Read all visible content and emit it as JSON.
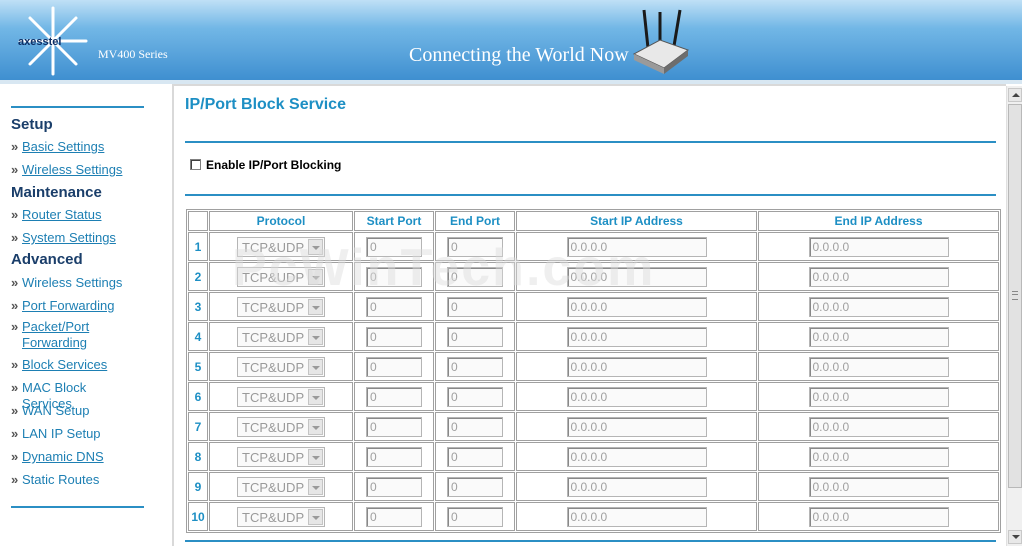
{
  "header": {
    "logo_text": "axesstel",
    "series": "MV400 Series",
    "tagline": "Connecting the World Now",
    "logo_icon": "starburst-logo-icon",
    "router_icon": "router-icon"
  },
  "colors": {
    "accent": "#2b8fc4",
    "link": "#1d7fb3",
    "heading": "#1a3e6a"
  },
  "sidebar": {
    "sections": [
      {
        "heading": "Setup",
        "items": [
          {
            "label": "Basic Settings",
            "link": true
          },
          {
            "label": "Wireless Settings",
            "link": true
          }
        ]
      },
      {
        "heading": "Maintenance",
        "items": [
          {
            "label": "Router Status",
            "link": true
          },
          {
            "label": "System Settings",
            "link": true
          }
        ]
      },
      {
        "heading": "Advanced",
        "items": [
          {
            "label": "Wireless Settings",
            "link": false
          },
          {
            "label": "Port Forwarding",
            "link": true
          },
          {
            "label": "Packet/Port Forwarding",
            "link": true
          },
          {
            "label": "Block Services",
            "link": true
          },
          {
            "label": "MAC Block Services",
            "link": false
          },
          {
            "label": "WAN Setup",
            "link": false
          },
          {
            "label": "LAN IP Setup",
            "link": false
          },
          {
            "label": "Dynamic DNS",
            "link": true
          },
          {
            "label": "Static Routes",
            "link": false
          }
        ]
      }
    ],
    "bullet": "»"
  },
  "main": {
    "title": "IP/Port Block Service",
    "enable_label": "Enable IP/Port Blocking",
    "table": {
      "headers": [
        "Protocol",
        "Start Port",
        "End Port",
        "Start IP Address",
        "End IP Address"
      ],
      "rows": [
        {
          "num": "1",
          "protocol": "TCP&UDP",
          "start_port": "0",
          "end_port": "0",
          "start_ip": "0.0.0.0",
          "end_ip": "0.0.0.0"
        },
        {
          "num": "2",
          "protocol": "TCP&UDP",
          "start_port": "0",
          "end_port": "0",
          "start_ip": "0.0.0.0",
          "end_ip": "0.0.0.0"
        },
        {
          "num": "3",
          "protocol": "TCP&UDP",
          "start_port": "0",
          "end_port": "0",
          "start_ip": "0.0.0.0",
          "end_ip": "0.0.0.0"
        },
        {
          "num": "4",
          "protocol": "TCP&UDP",
          "start_port": "0",
          "end_port": "0",
          "start_ip": "0.0.0.0",
          "end_ip": "0.0.0.0"
        },
        {
          "num": "5",
          "protocol": "TCP&UDP",
          "start_port": "0",
          "end_port": "0",
          "start_ip": "0.0.0.0",
          "end_ip": "0.0.0.0"
        },
        {
          "num": "6",
          "protocol": "TCP&UDP",
          "start_port": "0",
          "end_port": "0",
          "start_ip": "0.0.0.0",
          "end_ip": "0.0.0.0"
        },
        {
          "num": "7",
          "protocol": "TCP&UDP",
          "start_port": "0",
          "end_port": "0",
          "start_ip": "0.0.0.0",
          "end_ip": "0.0.0.0"
        },
        {
          "num": "8",
          "protocol": "TCP&UDP",
          "start_port": "0",
          "end_port": "0",
          "start_ip": "0.0.0.0",
          "end_ip": "0.0.0.0"
        },
        {
          "num": "9",
          "protocol": "TCP&UDP",
          "start_port": "0",
          "end_port": "0",
          "start_ip": "0.0.0.0",
          "end_ip": "0.0.0.0"
        },
        {
          "num": "10",
          "protocol": "TCP&UDP",
          "start_port": "0",
          "end_port": "0",
          "start_ip": "0.0.0.0",
          "end_ip": "0.0.0.0"
        }
      ]
    }
  },
  "watermark": "PcWinTech.com"
}
